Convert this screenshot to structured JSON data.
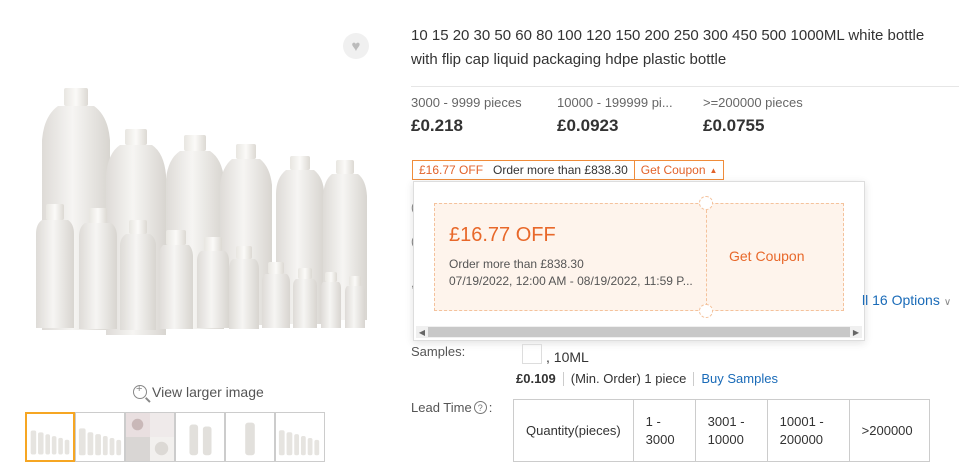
{
  "product": {
    "title": "10 15 20 30 50 60 80 100 120 150 200 250 300 450 500 1000ML white bottle with flip cap liquid packaging hdpe plastic bottle"
  },
  "gallery": {
    "view_larger": "View larger image",
    "thumbnail_count": 6,
    "active_thumbnail": 1
  },
  "price_tiers": [
    {
      "range": "3000 - 9999 pieces",
      "price": "£0.218"
    },
    {
      "range": "10000 - 199999 pi...",
      "price": "£0.0923"
    },
    {
      "range": ">=200000 pieces",
      "price": "£0.0755"
    }
  ],
  "coupon_tag": {
    "off": "£16.77 OFF",
    "condition": "Order more than £838.30",
    "get": "Get Coupon"
  },
  "coupon_popover": {
    "amount": "£16.77 OFF",
    "condition": "Order more than £838.30",
    "dates": "07/19/2022, 12:00 AM - 08/19/2022, 11:59 P...",
    "get": "Get Coupon"
  },
  "options": {
    "all_options": "ll 16 Options"
  },
  "samples": {
    "label": "Samples:",
    "size": ", 10ML",
    "price": "£0.109",
    "min_order": "(Min. Order) 1 piece",
    "buy": "Buy Samples"
  },
  "lead_time": {
    "label": "Lead Time",
    "header": [
      "Quantity(pieces)",
      "1 - 3000",
      "3001 - 10000",
      "10001 - 200000",
      ">200000"
    ]
  },
  "colors": {
    "accent": "#e8682a",
    "link": "#1a6bb8",
    "thumb_active": "#f6a623"
  }
}
